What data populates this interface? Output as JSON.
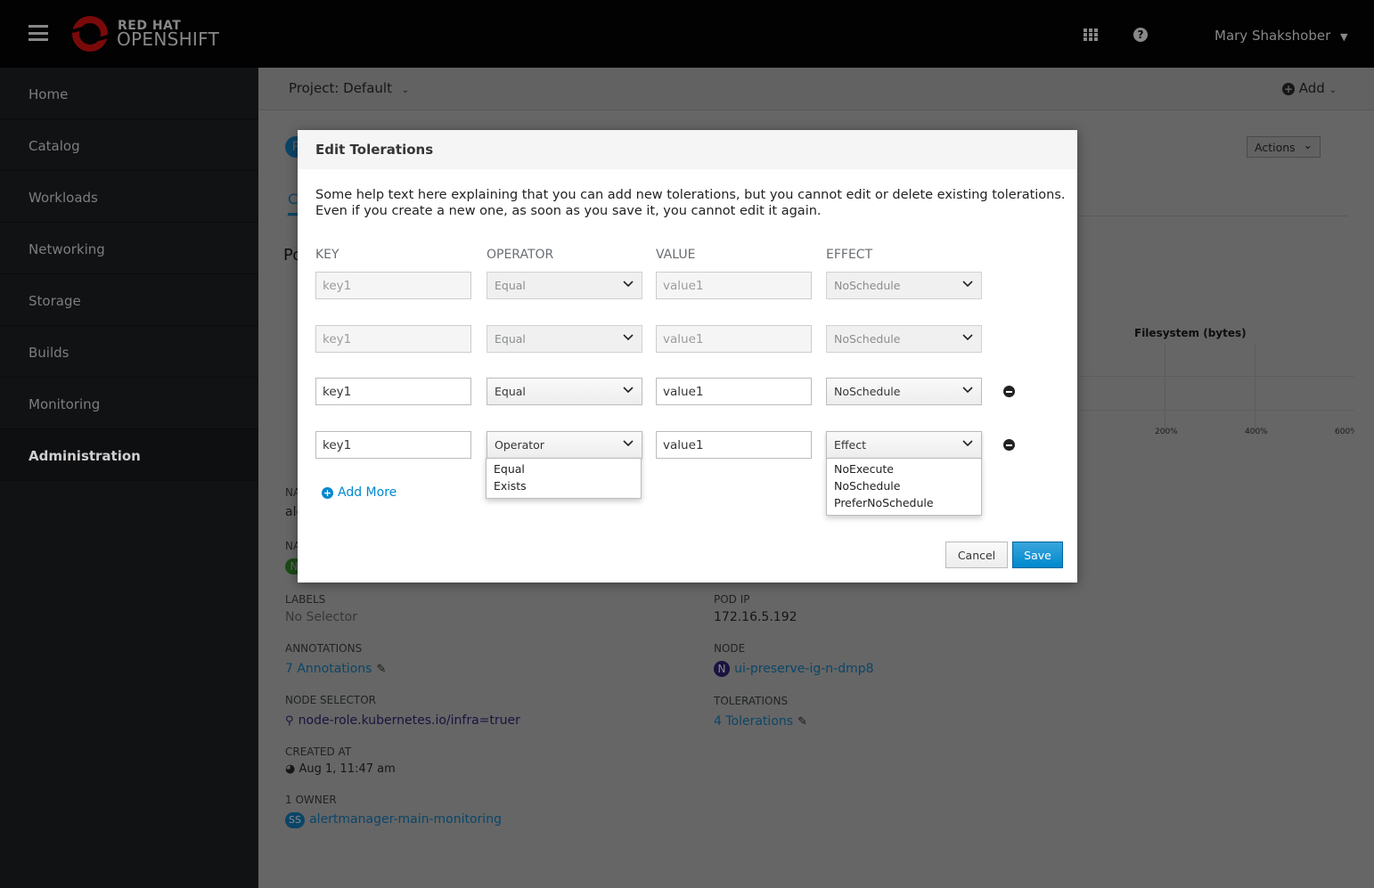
{
  "header": {
    "brand_top": "RED HAT",
    "brand_bottom": "OPENSHIFT",
    "user": "Mary Shakshober",
    "icons": [
      "hamburger-menu-icon",
      "openshift-logo",
      "app-launcher-icon",
      "help-icon",
      "caret-down-icon"
    ]
  },
  "sidebar": {
    "items": [
      {
        "label": "Home"
      },
      {
        "label": "Catalog"
      },
      {
        "label": "Workloads"
      },
      {
        "label": "Networking"
      },
      {
        "label": "Storage"
      },
      {
        "label": "Builds"
      },
      {
        "label": "Monitoring"
      },
      {
        "label": "Administration",
        "active": true
      }
    ]
  },
  "project_bar": {
    "project": "Project: Default",
    "add": "Add"
  },
  "page": {
    "actions": "Actions",
    "avatar_letter": "P",
    "tab_fragment": "C",
    "heading_fragment": "Po",
    "chart": {
      "title": "Filesystem (bytes)",
      "ticks": [
        "200%",
        "400%",
        "600%"
      ]
    },
    "fragments": [
      "NA",
      "ale",
      "NA",
      "N"
    ],
    "details_left": [
      {
        "label": "LABELS",
        "value": "No Selector"
      },
      {
        "label": "ANNOTATIONS",
        "value": "7 Annotations"
      },
      {
        "label": "NODE SELECTOR",
        "value": "node-role.kubernetes.io/infra=truer"
      },
      {
        "label": "CREATED AT",
        "value": "Aug 1, 11:47 am"
      },
      {
        "label": "1 OWNER",
        "badge": "SS",
        "value": "alertmanager-main-monitoring"
      }
    ],
    "details_right": [
      {
        "label": "POD IP",
        "value": "172.16.5.192"
      },
      {
        "label": "NODE",
        "badge": "N",
        "value": "ui-preserve-ig-n-dmp8"
      },
      {
        "label": "TOLERATIONS",
        "value": "4 Tolerations"
      }
    ]
  },
  "modal": {
    "title": "Edit Tolerations",
    "help": "Some help text here explaining that you can add new tolerations, but you cannot edit or delete existing tolerations. Even if you create a new one, as soon as you save it, you cannot edit it again.",
    "columns": [
      "KEY",
      "OPERATOR",
      "VALUE",
      "EFFECT"
    ],
    "rows": [
      {
        "key": "key1",
        "operator": "Equal",
        "value": "value1",
        "effect": "NoSchedule",
        "disabled": true
      },
      {
        "key": "key1",
        "operator": "Equal",
        "value": "value1",
        "effect": "NoSchedule",
        "disabled": true
      },
      {
        "key": "key1",
        "operator": "Equal",
        "value": "value1",
        "effect": "NoSchedule",
        "disabled": false
      },
      {
        "key": "key1",
        "operator": "Operator",
        "value": "value1",
        "effect": "Effect",
        "disabled": false
      }
    ],
    "operator_options": [
      "Equal",
      "Exists"
    ],
    "effect_options": [
      "NoExecute",
      "NoSchedule",
      "PreferNoSchedule"
    ],
    "add_more": "Add More",
    "cancel": "Cancel",
    "save": "Save"
  },
  "colors": {
    "accent": "#0088ce",
    "save_button": "#0088ce",
    "brand_red": "#cc0000"
  }
}
